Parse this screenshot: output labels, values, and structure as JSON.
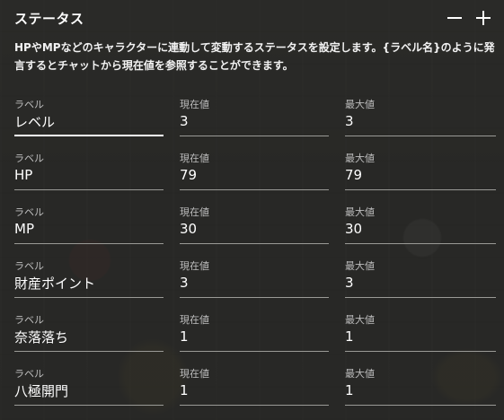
{
  "header": {
    "title": "ステータス"
  },
  "description": "HPやMPなどのキャラクターに連動して変動するステータスを設定します。{ラベル名}のように発言するとチャットから現在値を参照することができます。",
  "captions": {
    "label": "ラベル",
    "current": "現在値",
    "max": "最大値"
  },
  "statuses": [
    {
      "label": "レベル",
      "current": "3",
      "max": "3"
    },
    {
      "label": "HP",
      "current": "79",
      "max": "79"
    },
    {
      "label": "MP",
      "current": "30",
      "max": "30"
    },
    {
      "label": "財産ポイント",
      "current": "3",
      "max": "3"
    },
    {
      "label": "奈落落ち",
      "current": "1",
      "max": "1"
    },
    {
      "label": "八極開門",
      "current": "1",
      "max": "1"
    }
  ]
}
